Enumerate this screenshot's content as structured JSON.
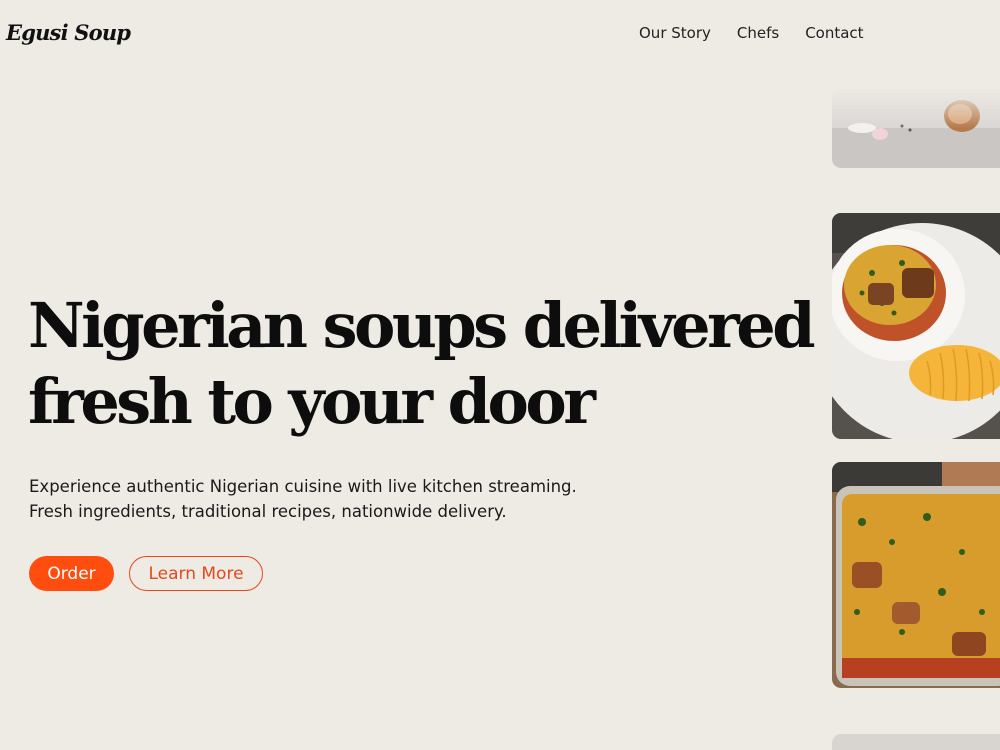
{
  "brand": {
    "name": "Egusi Soup"
  },
  "nav": {
    "items": [
      "Our Story",
      "Chefs",
      "Contact"
    ]
  },
  "hero": {
    "title_line1": "Nigerian soups delivered",
    "title_line2": "fresh to your door",
    "subtitle_line1": "Experience authentic Nigerian cuisine with live kitchen streaming.",
    "subtitle_line2": "Fresh ingredients, traditional recipes, nationwide delivery."
  },
  "buttons": {
    "order": "Order",
    "learn_more": "Learn More"
  },
  "colors": {
    "background": "#eeeae4",
    "accent": "#ff4d0f",
    "text": "#0d0d0d"
  },
  "gallery": [
    {
      "icon": "ingredients-photo"
    },
    {
      "icon": "egusi-soup-with-eba-photo"
    },
    {
      "icon": "egusi-soup-container-photo"
    },
    {
      "icon": "food-photo"
    }
  ]
}
